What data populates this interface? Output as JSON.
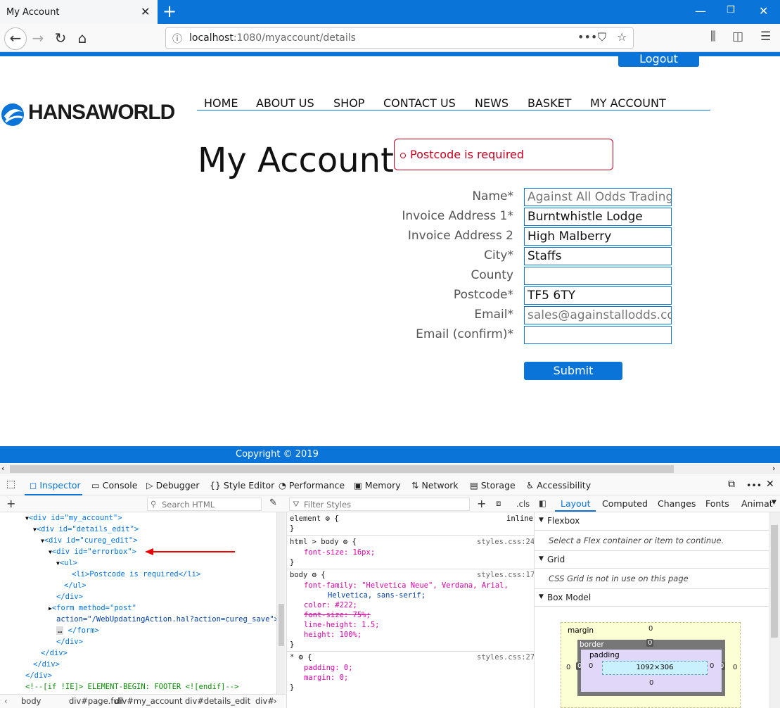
{
  "browser": {
    "tab_title": "My Account",
    "url_host": "localhost",
    "url_path": ":1080/myaccount/details"
  },
  "page": {
    "logout_label": "Logout",
    "logo_text": "HANSAWORLD",
    "menu": [
      "HOME",
      "ABOUT US",
      "SHOP",
      "CONTACT US",
      "NEWS",
      "BASKET",
      "MY ACCOUNT"
    ],
    "heading": "My Account",
    "error": "Postcode is required",
    "fields": [
      {
        "label": "Name*",
        "value": "Against All Odds Trading",
        "placeholder_style": true
      },
      {
        "label": "Invoice Address 1*",
        "value": "Burntwhistle Lodge"
      },
      {
        "label": "Invoice Address 2",
        "value": "High Malberry"
      },
      {
        "label": "City*",
        "value": "Staffs"
      },
      {
        "label": "County",
        "value": ""
      },
      {
        "label": "Postcode*",
        "value": "TF5 6TY"
      },
      {
        "label": "Email*",
        "value": "sales@againstallodds.cor",
        "placeholder_style": true
      },
      {
        "label": "Email (confirm)*",
        "value": ""
      }
    ],
    "submit_label": "Submit",
    "footer": "Copyright © 2019"
  },
  "devtools": {
    "tabs": [
      "Inspector",
      "Console",
      "Debugger",
      "Style Editor",
      "Performance",
      "Memory",
      "Network",
      "Storage",
      "Accessibility"
    ],
    "search_html_placeholder": "Search HTML",
    "filter_styles_placeholder": "Filter Styles",
    "cls_label": ".cls",
    "layout_tabs": [
      "Layout",
      "Computed",
      "Changes",
      "Fonts",
      "Animat"
    ],
    "flexbox_title": "Flexbox",
    "flexbox_note": "Select a Flex container or item to continue.",
    "grid_title": "Grid",
    "grid_note": "CSS Grid is not in use on this page",
    "boxmodel_title": "Box Model",
    "box": {
      "margin": "margin",
      "border": "border",
      "padding": "padding",
      "content": "1092×306",
      "zero": "0"
    },
    "html_lines": [
      "<div id=\"my_account\">",
      "<div id=\"details_edit\">",
      "<div id=\"cureg_edit\">",
      "<div id=\"errorbox\">",
      "<ul>",
      "<li>Postcode is required</li>",
      "</ul>",
      "</div>",
      "<form method=\"post\"",
      "action=\"/WebUpdatingAction.hal?action=cureg_save\">",
      "</form>",
      "</div>",
      "</div>",
      "</div>",
      "<!--[if !IE]> ELEMENT-BEGIN: FOOTER <![endif]-->"
    ],
    "css_lines": {
      "element": "element",
      "inline": "inline",
      "html_body": "html > body",
      "src24": "styles.css:24",
      "font_size_16": "font-size: 16px;",
      "body": "body",
      "src17": "styles.css:17",
      "font_family": "font-family: \"Helvetica Neue\", Verdana, Arial,",
      "font_family2": "Helvetica, sans-serif;",
      "color": "color: #222;",
      "font_size_75": "font-size: 75%;",
      "line_height": "line-height: 1.5;",
      "height": "height: 100%;",
      "star": "*",
      "src27": "styles.css:27",
      "padding": "padding: 0;",
      "margin": "margin: 0;"
    },
    "breadcrumbs": [
      "body",
      "div#page.full",
      "div#my_account",
      "div#details_edit",
      "div#"
    ]
  }
}
